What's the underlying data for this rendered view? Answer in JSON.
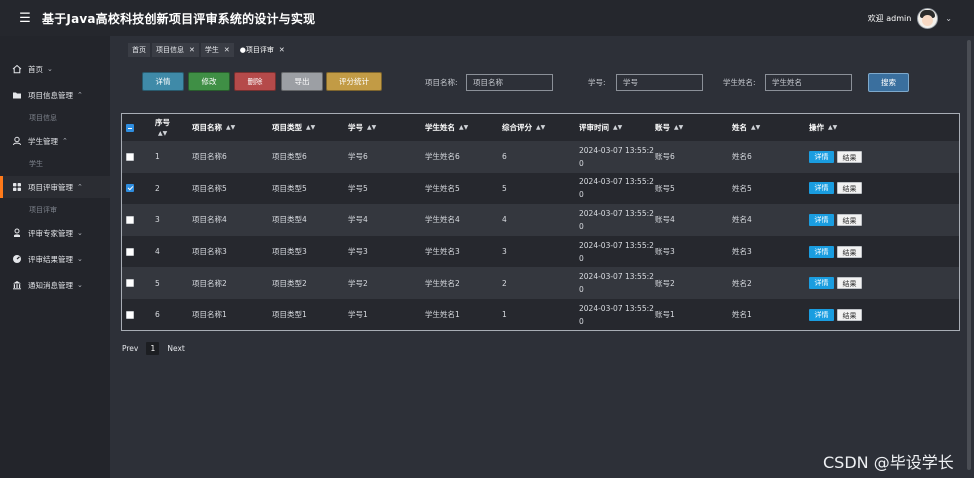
{
  "header": {
    "menu_icon": "hamburger-icon",
    "title": "基于Java高校科技创新项目评审系统的设计与实现",
    "welcome": "欢迎 admin",
    "caret": "⌄"
  },
  "sidebar": {
    "items": [
      {
        "label": "首页",
        "icon": "home-icon",
        "caret": "⌄"
      },
      {
        "label": "项目信息管理",
        "icon": "folder-icon",
        "caret": "⌃",
        "sub": "项目信息"
      },
      {
        "label": "学生管理",
        "icon": "user-icon",
        "caret": "⌃",
        "sub": "学生"
      },
      {
        "label": "项目评审管理",
        "icon": "grid-icon",
        "caret": "⌃",
        "sub": "项目评审"
      },
      {
        "label": "评审专家管理",
        "icon": "person-icon",
        "caret": "⌄"
      },
      {
        "label": "评审结果管理",
        "icon": "gauge-icon",
        "caret": "⌄"
      },
      {
        "label": "通知消息管理",
        "icon": "bank-icon",
        "caret": "⌄"
      }
    ],
    "accent": "#ff7a1a"
  },
  "tabs": [
    {
      "label": "首页",
      "closable": false
    },
    {
      "label": "项目信息",
      "closable": true
    },
    {
      "label": "学生",
      "closable": true
    },
    {
      "label": "●项目评审",
      "closable": true
    }
  ],
  "toolbar": {
    "detail": "详情",
    "edit": "修改",
    "delete": "删除",
    "export": "导出",
    "stats": "评分统计",
    "search": "搜索"
  },
  "filters": {
    "project_name_label": "项目名称:",
    "project_name_placeholder": "项目名称",
    "student_no_label": "学号:",
    "student_no_placeholder": "学号",
    "student_name_label": "学生姓名:",
    "student_name_placeholder": "学生姓名"
  },
  "table": {
    "columns": [
      "序号",
      "项目名称",
      "项目类型",
      "学号",
      "学生姓名",
      "综合评分",
      "评审时间",
      "账号",
      "姓名",
      "操作"
    ],
    "rows": [
      {
        "checked": false,
        "no": "1",
        "project": "项目名称6",
        "type": "项目类型6",
        "sid": "学号6",
        "sname": "学生姓名6",
        "score": "6",
        "time1": "2024-03-07 13:55:2",
        "time2": "0",
        "account": "账号6",
        "name": "姓名6"
      },
      {
        "checked": true,
        "no": "2",
        "project": "项目名称5",
        "type": "项目类型5",
        "sid": "学号5",
        "sname": "学生姓名5",
        "score": "5",
        "time1": "2024-03-07 13:55:2",
        "time2": "0",
        "account": "账号5",
        "name": "姓名5"
      },
      {
        "checked": false,
        "no": "3",
        "project": "项目名称4",
        "type": "项目类型4",
        "sid": "学号4",
        "sname": "学生姓名4",
        "score": "4",
        "time1": "2024-03-07 13:55:2",
        "time2": "0",
        "account": "账号4",
        "name": "姓名4"
      },
      {
        "checked": false,
        "no": "4",
        "project": "项目名称3",
        "type": "项目类型3",
        "sid": "学号3",
        "sname": "学生姓名3",
        "score": "3",
        "time1": "2024-03-07 13:55:2",
        "time2": "0",
        "account": "账号3",
        "name": "姓名3"
      },
      {
        "checked": false,
        "no": "5",
        "project": "项目名称2",
        "type": "项目类型2",
        "sid": "学号2",
        "sname": "学生姓名2",
        "score": "2",
        "time1": "2024-03-07 13:55:2",
        "time2": "0",
        "account": "账号2",
        "name": "姓名2"
      },
      {
        "checked": false,
        "no": "6",
        "project": "项目名称1",
        "type": "项目类型1",
        "sid": "学号1",
        "sname": "学生姓名1",
        "score": "1",
        "time1": "2024-03-07 13:55:2",
        "time2": "0",
        "account": "账号1",
        "name": "姓名1"
      }
    ],
    "op_detail": "详情",
    "op_result": "结果",
    "sort_glyph": "▲▼"
  },
  "pager": {
    "prev": "Prev",
    "current": "1",
    "next": "Next"
  },
  "watermark": "CSDN @毕设学长"
}
